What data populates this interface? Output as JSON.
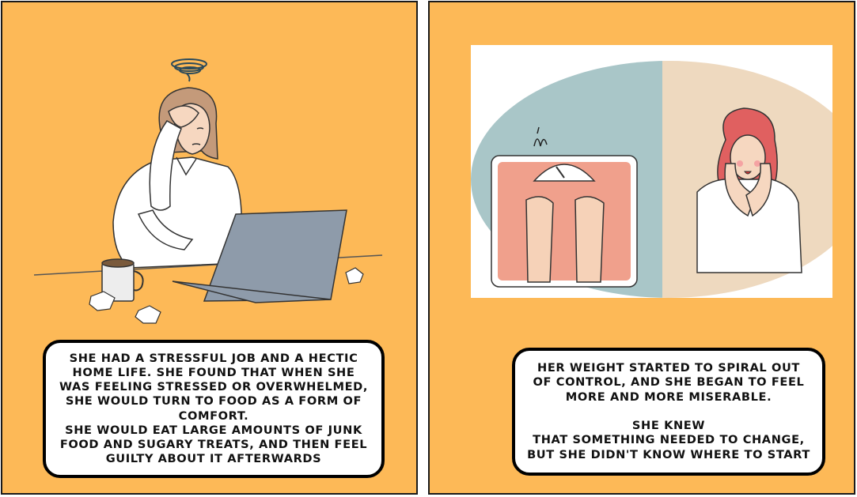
{
  "panels": [
    {
      "illustration": "stressed woman at laptop with coffee mug and crumpled paper",
      "caption": "SHE HAD A STRESSFUL JOB AND A HECTIC\nHOME LIFE. SHE FOUND THAT WHEN SHE\nWAS FEELING STRESSED OR OVERWHELMED,\nSHE WOULD TURN TO FOOD AS A FORM OF\nCOMFORT.\nSHE WOULD EAT LARGE AMOUNTS OF JUNK\nFOOD AND SUGARY TREATS, AND THEN FEEL\nGUILTY ABOUT IT AFTERWARDS"
    },
    {
      "illustration": "feet on bathroom scale and worried woman holding face",
      "caption": "HER WEIGHT STARTED TO SPIRAL OUT\nOF CONTROL, AND SHE BEGAN TO FEEL\nMORE AND MORE MISERABLE.\n\nSHE KNEW\nTHAT SOMETHING NEEDED TO CHANGE,\nBUT SHE DIDN'T KNOW WHERE TO START"
    }
  ],
  "colors": {
    "panel_bg": "#FDB957",
    "caption_bg": "#FFFFFF",
    "caption_border": "#000000",
    "scale_pink": "#F0A08C",
    "wall_blue": "#A9C6C8",
    "wall_beige": "#EED9BF"
  }
}
